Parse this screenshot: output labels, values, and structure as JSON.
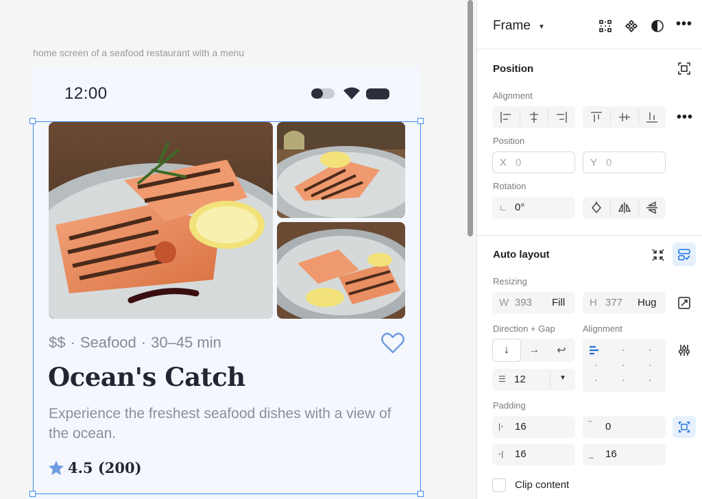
{
  "canvas": {
    "frame_label": "home screen of a seafood restaurant with a menu",
    "status_bar": {
      "time": "12:00"
    },
    "card": {
      "price": "$$",
      "separator": "·",
      "category": "Seafood",
      "duration": "30–45 min",
      "title": "Ocean's Catch",
      "description": "Experience the freshest seafood dishes with a view of the ocean.",
      "rating": "4.5 (200)"
    }
  },
  "panel": {
    "frame_title": "Frame",
    "position": {
      "heading": "Position",
      "alignment_label": "Alignment",
      "position_label": "Position",
      "x_prefix": "X",
      "x_value": "0",
      "y_prefix": "Y",
      "y_value": "0",
      "rotation_label": "Rotation",
      "rotation_value": "0°"
    },
    "auto_layout": {
      "heading": "Auto layout",
      "resizing_label": "Resizing",
      "w_prefix": "W",
      "w_value": "393",
      "w_mode": "Fill",
      "h_prefix": "H",
      "h_value": "377",
      "h_mode": "Hug",
      "direction_label": "Direction + Gap",
      "alignment_label": "Alignment",
      "gap_value": "12",
      "padding_label": "Padding",
      "pad_left": "16",
      "pad_top": "0",
      "pad_right": "16",
      "pad_bottom": "16",
      "clip_label": "Clip content"
    }
  },
  "colors": {
    "selection": "#3a8bf0",
    "accent": "#1e6fd9",
    "star": "#6f9be0"
  }
}
